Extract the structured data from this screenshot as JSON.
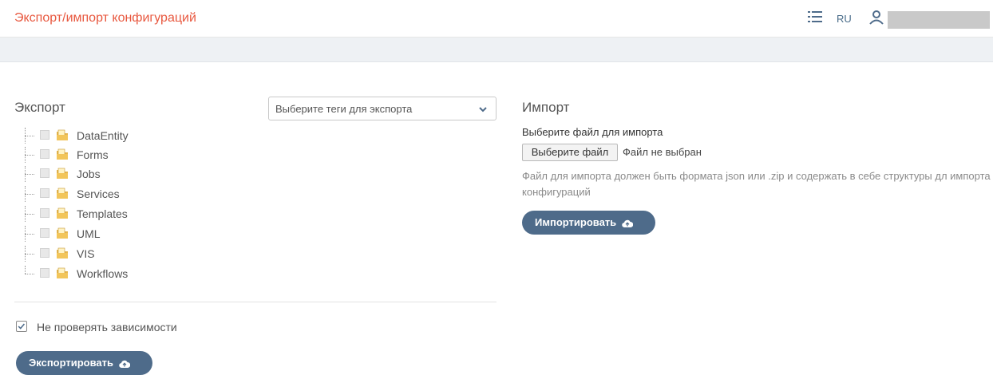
{
  "header": {
    "title": "Экспорт/импорт конфигураций",
    "lang": "RU",
    "menu_icon": "list-icon",
    "user_icon": "user-icon"
  },
  "export": {
    "heading": "Экспорт",
    "tags_placeholder": "Выберите теги для экспорта",
    "tree": [
      {
        "label": "DataEntity"
      },
      {
        "label": "Forms"
      },
      {
        "label": "Jobs"
      },
      {
        "label": "Services"
      },
      {
        "label": "Templates"
      },
      {
        "label": "UML"
      },
      {
        "label": "VIS"
      },
      {
        "label": "Workflows"
      }
    ],
    "skip_deps_label": "Не проверять зависимости",
    "skip_deps_checked": true,
    "button_label": "Экспортировать"
  },
  "import": {
    "heading": "Импорт",
    "file_label": "Выберите файл для импорта",
    "file_button": "Выберите файл",
    "file_status": "Файл не выбран",
    "hint": "Файл для импорта должен быть формата json или .zip и содержать в себе структуры дл импорта конфигураций",
    "button_label": "Импортировать"
  },
  "colors": {
    "accent": "#e8583f",
    "button": "#4e6b8a"
  }
}
